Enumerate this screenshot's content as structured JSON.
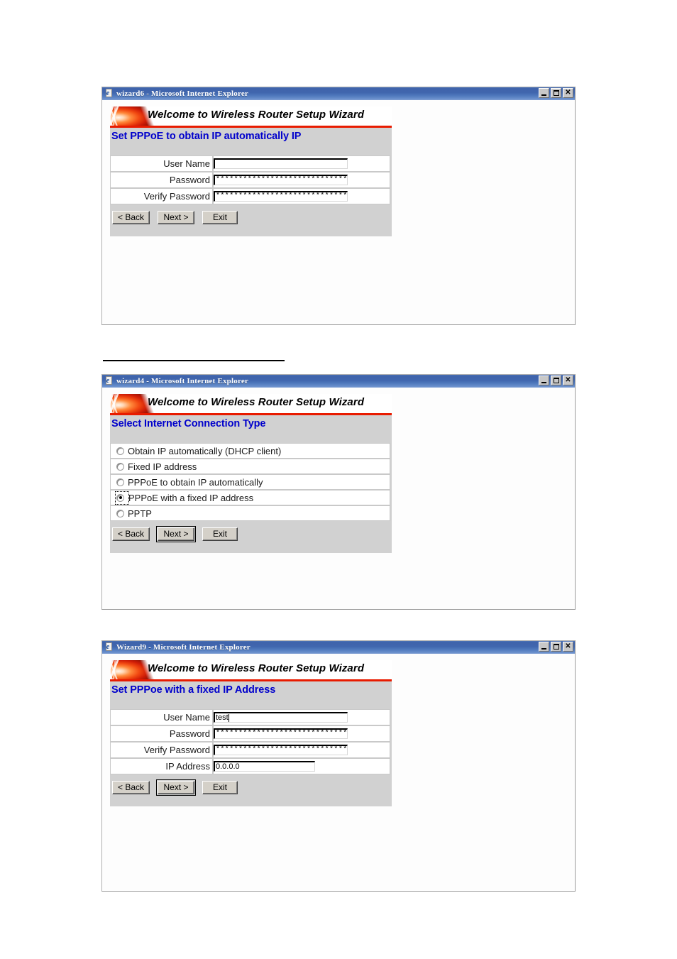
{
  "document": {
    "separator_rule": "horizontal-black-rule"
  },
  "common": {
    "banner_title": "Welcome to Wireless Router Setup Wizard",
    "buttons": {
      "back": "< Back",
      "next": "Next >",
      "exit": "Exit"
    },
    "window_controls": {
      "minimize": "minimize",
      "maximize": "maximize",
      "close": "close"
    },
    "colors": {
      "titlebar_blue": "#3f63ab",
      "heading_blue": "#0000cc",
      "panel_gray": "#d1d1d1",
      "banner_rule_red": "#e81b00",
      "button_face": "#d4d0c8"
    }
  },
  "windows": [
    {
      "title": "wizard6 - Microsoft Internet Explorer",
      "page_title": "Set PPPoE to obtain IP automatically IP",
      "fields": [
        {
          "label": "User Name",
          "value": "",
          "type": "text",
          "width": "wide"
        },
        {
          "label": "Password",
          "value": "********************************",
          "type": "password",
          "width": "wide"
        },
        {
          "label": "Verify Password",
          "value": "********************************",
          "type": "password",
          "width": "wide"
        }
      ],
      "default_button": "none"
    },
    {
      "title": "wizard4 - Microsoft Internet Explorer",
      "page_title": "Select Internet Connection Type",
      "options": [
        {
          "label": "Obtain IP automatically (DHCP client)",
          "selected": false
        },
        {
          "label": "Fixed IP address",
          "selected": false
        },
        {
          "label": "PPPoE to obtain IP automatically",
          "selected": false
        },
        {
          "label": "PPPoE with a fixed IP address",
          "selected": true
        },
        {
          "label": "PPTP",
          "selected": false
        }
      ],
      "default_button": "next"
    },
    {
      "title": "Wizard9 - Microsoft Internet Explorer",
      "page_title": "Set PPPoe with a fixed IP Address",
      "fields": [
        {
          "label": "User Name",
          "value": "test",
          "type": "text",
          "width": "wide",
          "caret": true
        },
        {
          "label": "Password",
          "value": "*****************************",
          "type": "password",
          "width": "wide"
        },
        {
          "label": "Verify Password",
          "value": "*******************************",
          "type": "password",
          "width": "wide"
        },
        {
          "label": "IP Address",
          "value": "0.0.0.0",
          "type": "text",
          "width": "ip"
        }
      ],
      "default_button": "next"
    }
  ]
}
